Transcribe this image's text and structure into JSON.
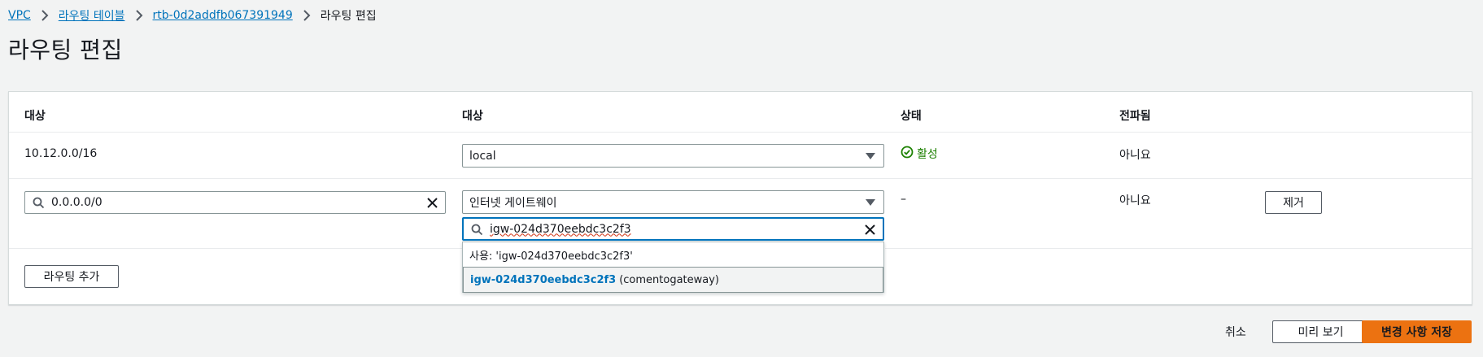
{
  "breadcrumb": {
    "items": [
      "VPC",
      "라우팅 테이블",
      "rtb-0d2addfb067391949"
    ],
    "current": "라우팅 편집"
  },
  "page": {
    "title": "라우팅 편집"
  },
  "table": {
    "headers": {
      "destination": "대상",
      "target": "대상",
      "status": "상태",
      "propagated": "전파됨"
    },
    "row1": {
      "destination": "10.12.0.0/16",
      "target": "local",
      "status": "활성",
      "propagated": "아니요"
    },
    "row2": {
      "destination_value": "0.0.0.0/0",
      "target": "인터넷 게이트웨이",
      "target_search_value": "igw-024d370eebdc3c2f3",
      "status": "–",
      "propagated": "아니요",
      "remove_label": "제거"
    },
    "dropdown": {
      "use_option": "사용: 'igw-024d370eebdc3c2f3'",
      "igw_id": "igw-024d370eebdc3c2f3",
      "igw_name": "(comentogateway)"
    },
    "add_route_label": "라우팅 추가"
  },
  "footer": {
    "cancel_label": "취소",
    "preview_label": "미리 보기",
    "save_label": "변경 사항 저장"
  },
  "colors": {
    "accent": "#0073bb",
    "primary": "#ec7211",
    "success": "#1d8102"
  }
}
